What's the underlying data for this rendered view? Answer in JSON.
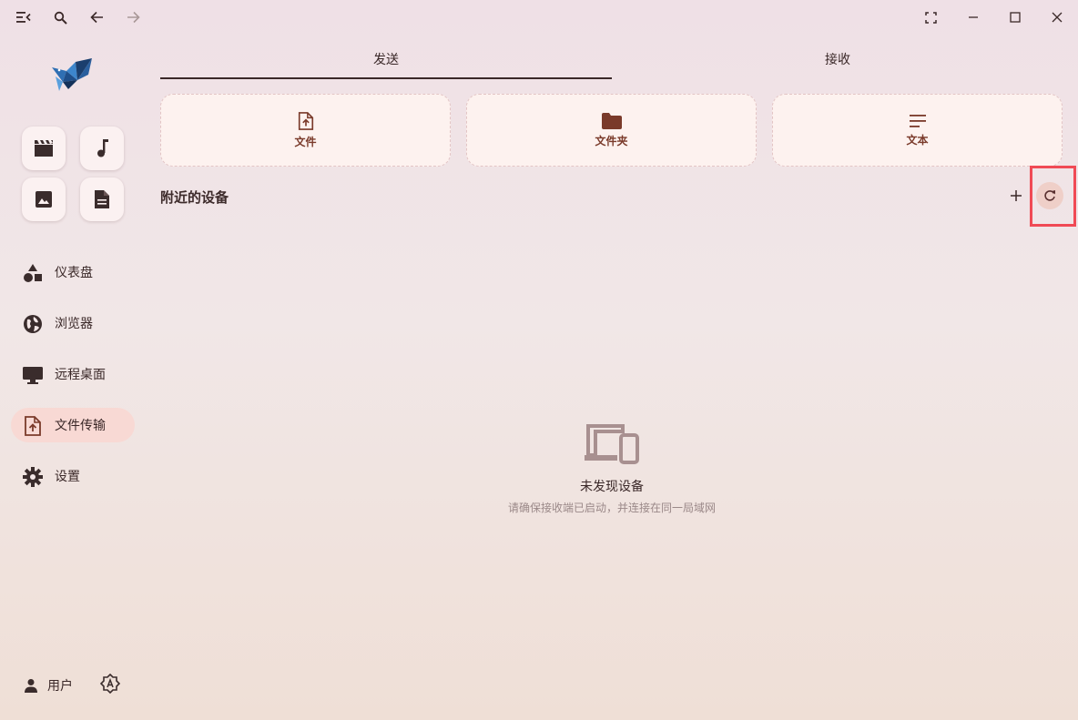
{
  "titlebar": {
    "icons": [
      "menu-collapse-icon",
      "search-icon",
      "back-arrow-icon",
      "forward-arrow-icon",
      "fullscreen-icon",
      "minimize-icon",
      "maximize-icon",
      "close-icon"
    ]
  },
  "sidebar": {
    "quick_icons": [
      "video-icon",
      "music-icon",
      "image-icon",
      "document-icon"
    ],
    "nav": [
      {
        "label": "仪表盘",
        "icon": "shapes-icon"
      },
      {
        "label": "浏览器",
        "icon": "globe-icon"
      },
      {
        "label": "远程桌面",
        "icon": "monitor-icon"
      },
      {
        "label": "文件传输",
        "icon": "file-upload-icon",
        "active": true
      },
      {
        "label": "设置",
        "icon": "gear-icon"
      }
    ],
    "footer": {
      "user_label": "用户",
      "user_icon": "person-icon",
      "theme_icon": "auto-brightness-icon"
    }
  },
  "main": {
    "tabs": [
      {
        "label": "发送",
        "active": true
      },
      {
        "label": "接收",
        "active": false
      }
    ],
    "send_options": [
      {
        "label": "文件",
        "icon": "file-upload-icon"
      },
      {
        "label": "文件夹",
        "icon": "folder-icon"
      },
      {
        "label": "文本",
        "icon": "text-lines-icon"
      }
    ],
    "nearby": {
      "title": "附近的设备",
      "empty_title": "未发现设备",
      "empty_subtitle": "请确保接收端已启动，并连接在同一局域网"
    }
  },
  "colors": {
    "accent": "#7a3a2a",
    "active_nav_bg": "#f8d9d4",
    "card_bg": "#fdf2ef",
    "highlight": "#f04a55"
  }
}
